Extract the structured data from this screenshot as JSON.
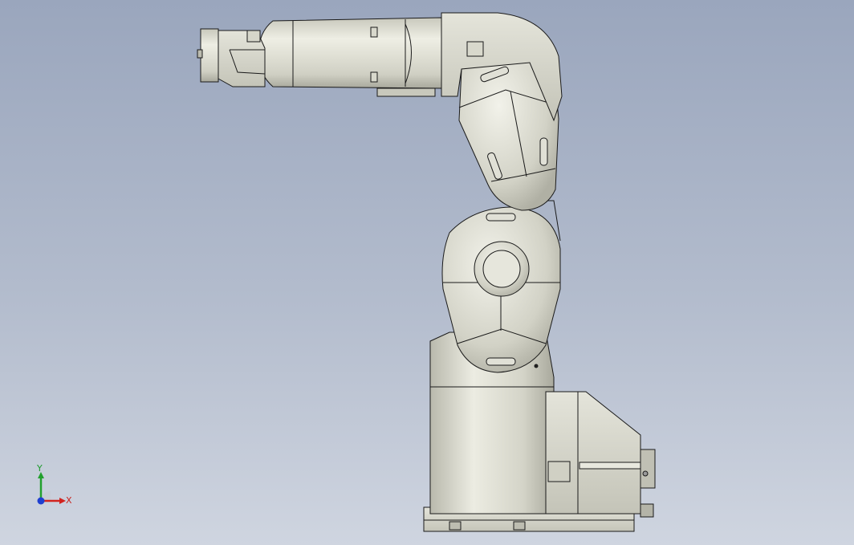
{
  "viewport": {
    "background_top": "#9aa6bd",
    "background_bottom": "#cfd5e0",
    "model": "six-axis-robot-arm",
    "part_color": "#d8d8cc",
    "edge_color": "#1a1a1a"
  },
  "triad": {
    "x_label": "X",
    "y_label": "Y",
    "x_color": "#d2231e",
    "y_color": "#22a02e",
    "z_color": "#1f3fd0"
  }
}
